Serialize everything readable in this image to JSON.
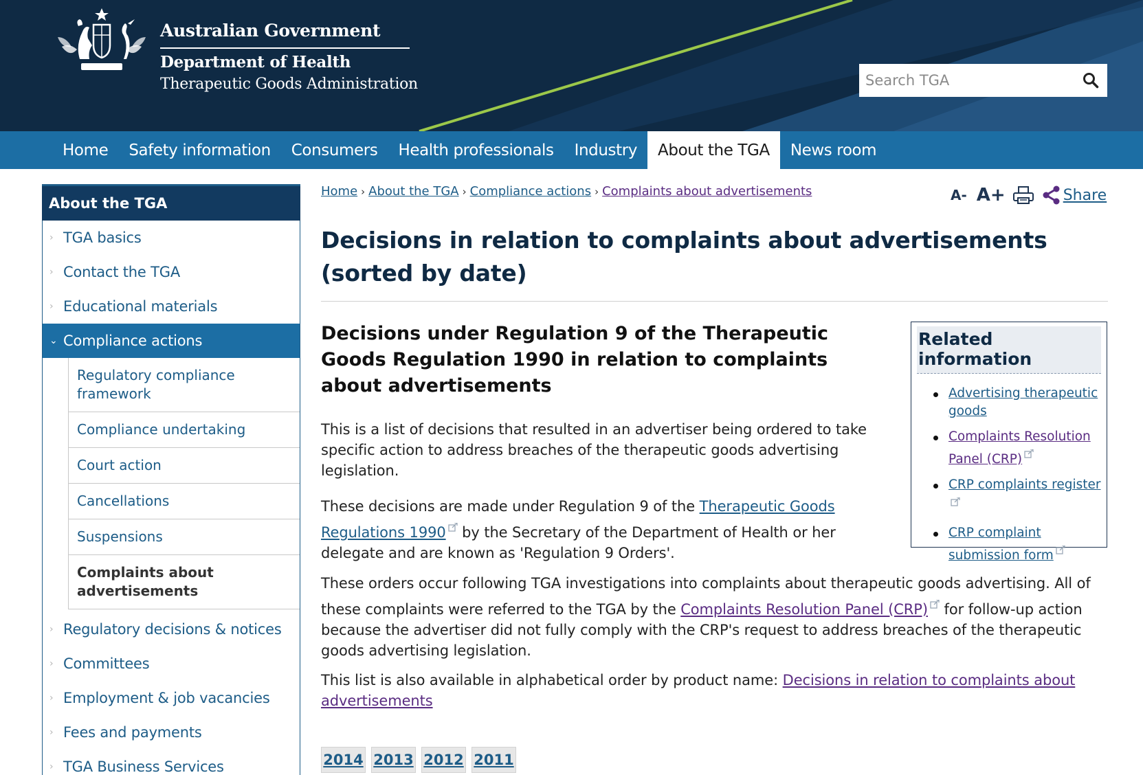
{
  "header": {
    "gov_name": "Australian Government",
    "dept_name": "Department of Health",
    "agency_name": "Therapeutic Goods Administration",
    "search_placeholder": "Search TGA",
    "search_icon": "magnifier-icon",
    "crest_icon": "coat-of-arms-icon"
  },
  "colors": {
    "header_bg": "#0f2a44",
    "nav_bg": "#1c6ea4",
    "accent_line": "#9cc84a",
    "link": "#1d5c87",
    "visited": "#5a2c82"
  },
  "nav": {
    "items": [
      {
        "label": "Home"
      },
      {
        "label": "Safety information"
      },
      {
        "label": "Consumers"
      },
      {
        "label": "Health professionals"
      },
      {
        "label": "Industry"
      },
      {
        "label": "About the TGA",
        "active": true
      },
      {
        "label": "News room"
      }
    ]
  },
  "sidebar": {
    "title": "About the TGA",
    "items_before": [
      {
        "label": "TGA basics"
      },
      {
        "label": "Contact the TGA"
      },
      {
        "label": "Educational materials"
      }
    ],
    "active_item": {
      "label": "Compliance actions"
    },
    "sub_items": [
      {
        "label": "Regulatory compliance framework"
      },
      {
        "label": "Compliance undertaking"
      },
      {
        "label": "Court action"
      },
      {
        "label": "Cancellations"
      },
      {
        "label": "Suspensions"
      },
      {
        "label": "Complaints about advertisements",
        "current": true
      }
    ],
    "items_after": [
      {
        "label": "Regulatory decisions & notices"
      },
      {
        "label": "Committees"
      },
      {
        "label": "Employment & job vacancies"
      },
      {
        "label": "Fees and payments"
      },
      {
        "label": "TGA Business Services"
      }
    ]
  },
  "breadcrumb": {
    "items": [
      "Home",
      "About the TGA",
      "Compliance actions",
      "Complaints about advertisements"
    ],
    "separator": "›"
  },
  "tools": {
    "font_decrease": "A-",
    "font_increase": "A+",
    "print_icon": "printer-icon",
    "share_icon": "share-icon",
    "share_label": "Share"
  },
  "main": {
    "title": "Decisions in relation to complaints about advertisements (sorted by date)",
    "section_heading": "Decisions under Regulation 9 of the Therapeutic Goods Regulation 1990 in relation to complaints about advertisements",
    "p1": "This is a list of decisions that resulted in an advertiser being ordered to take specific action to address breaches of the therapeutic goods advertising legislation.",
    "p2_before": "These decisions are made under Regulation 9 of the ",
    "p2_link": "Therapeutic Goods Regulations 1990",
    "p2_after": " by the Secretary of the Department of Health or her delegate and are known as 'Regulation 9 Orders'.",
    "p3_before": "These orders occur following TGA investigations into complaints about therapeutic goods advertising. All of these complaints were referred to the TGA by the ",
    "p3_link": "Complaints Resolution Panel (CRP)",
    "p3_after": " for follow-up action because the advertiser did not fully comply with the CRP's request to address breaches of the therapeutic goods advertising legislation.",
    "p4_before": "This list is also available in alphabetical order by product name: ",
    "p4_link": "Decisions in relation to complaints about advertisements",
    "external_icon": "external-link-icon"
  },
  "related": {
    "heading": "Related information",
    "links": [
      {
        "label": "Advertising therapeutic goods",
        "external": false,
        "visited": false
      },
      {
        "label": "Complaints Resolution Panel (CRP)",
        "external": true,
        "visited": true
      },
      {
        "label": "CRP complaints register",
        "external": true,
        "visited": false
      },
      {
        "label": "CRP complaint submission form",
        "external": true,
        "visited": false
      }
    ]
  },
  "year_tabs": [
    "2014",
    "2013",
    "2012",
    "2011"
  ]
}
